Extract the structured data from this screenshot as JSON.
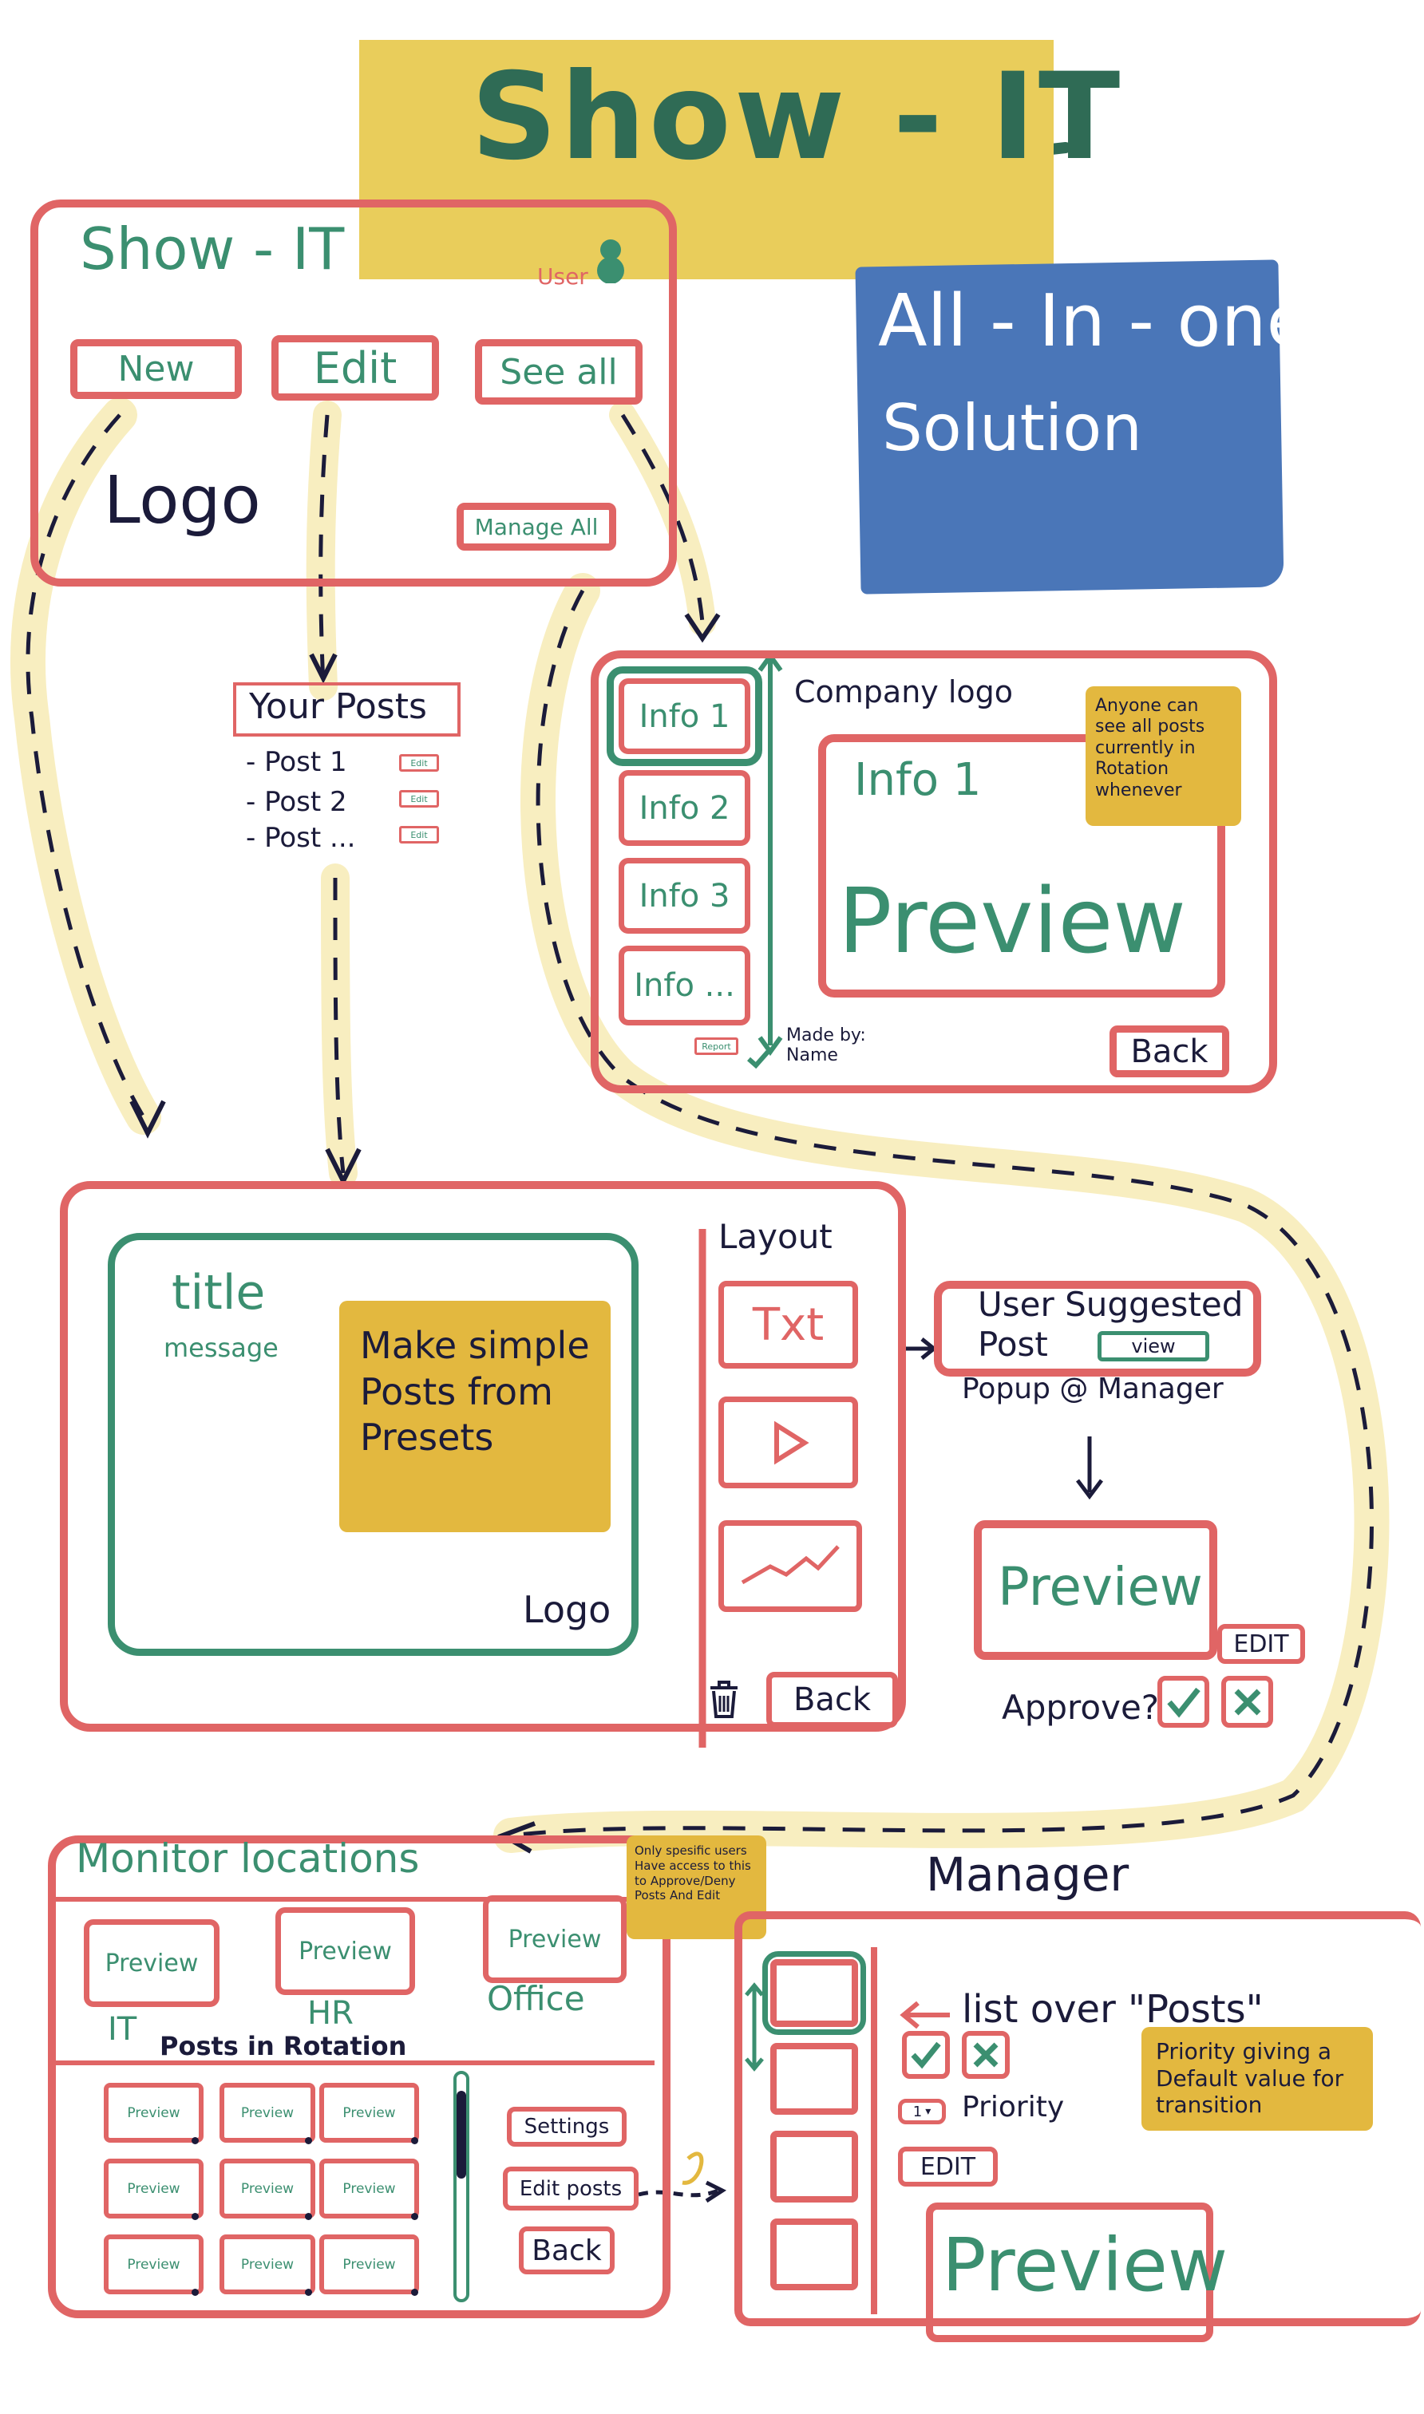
{
  "banner": {
    "title": "Show - IT"
  },
  "tagline": {
    "line1": "All - In - one",
    "line2": "Solution"
  },
  "home": {
    "title": "Show - IT",
    "user_label": "User",
    "new_label": "New",
    "edit_label": "Edit",
    "see_all_label": "See all",
    "logo_label": "Logo",
    "manage_all_label": "Manage All"
  },
  "your_posts": {
    "heading": "Your Posts",
    "items": [
      {
        "label": "- Post 1",
        "edit": "Edit"
      },
      {
        "label": "- Post 2",
        "edit": "Edit"
      },
      {
        "label": "- Post ...",
        "edit": "Edit"
      }
    ]
  },
  "see_all_screen": {
    "company_logo": "Company logo",
    "info_items": [
      "Info 1",
      "Info 2",
      "Info 3",
      "Info ..."
    ],
    "preview_title": "Info 1",
    "preview_label": "Preview",
    "note": "Anyone can see all posts currently in Rotation whenever",
    "made_by": "Made by: Name",
    "report_label": "Report",
    "back_label": "Back"
  },
  "editor": {
    "title_label": "title",
    "message_label": "message",
    "note": "Make simple Posts from Presets",
    "logo_label": "Logo",
    "layout_heading": "Layout",
    "txt_label": "Txt",
    "back_label": "Back"
  },
  "popup": {
    "line1": "User Suggested",
    "line2": "Post",
    "view_label": "view",
    "caption": "Popup @ Manager",
    "preview_label": "Preview",
    "edit_label": "EDIT",
    "approve_label": "Approve?"
  },
  "monitor": {
    "heading": "Monitor locations",
    "note": "Only spesific users Have access to this to Approve/Deny Posts And Edit",
    "locations": [
      {
        "preview": "Preview",
        "name": "IT"
      },
      {
        "preview": "Preview",
        "name": "HR"
      },
      {
        "preview": "Preview",
        "name": "Office"
      }
    ],
    "rotation_heading": "Posts in Rotation",
    "grid_label": "Preview",
    "settings_label": "Settings",
    "edit_posts_label": "Edit posts",
    "back_label": "Back"
  },
  "manager": {
    "heading": "Manager",
    "list_label": "list over \"Posts\"",
    "priority_value": "1",
    "priority_label": "Priority",
    "edit_label": "EDIT",
    "preview_label": "Preview",
    "note": "Priority giving a Default value for transition"
  },
  "colors": {
    "red": "#e06565",
    "green": "#3b8f70",
    "navy": "#1b1b3a",
    "yellow": "#e3b83f",
    "blue": "#4a76b8",
    "pale_yellow": "#f8eec0"
  }
}
